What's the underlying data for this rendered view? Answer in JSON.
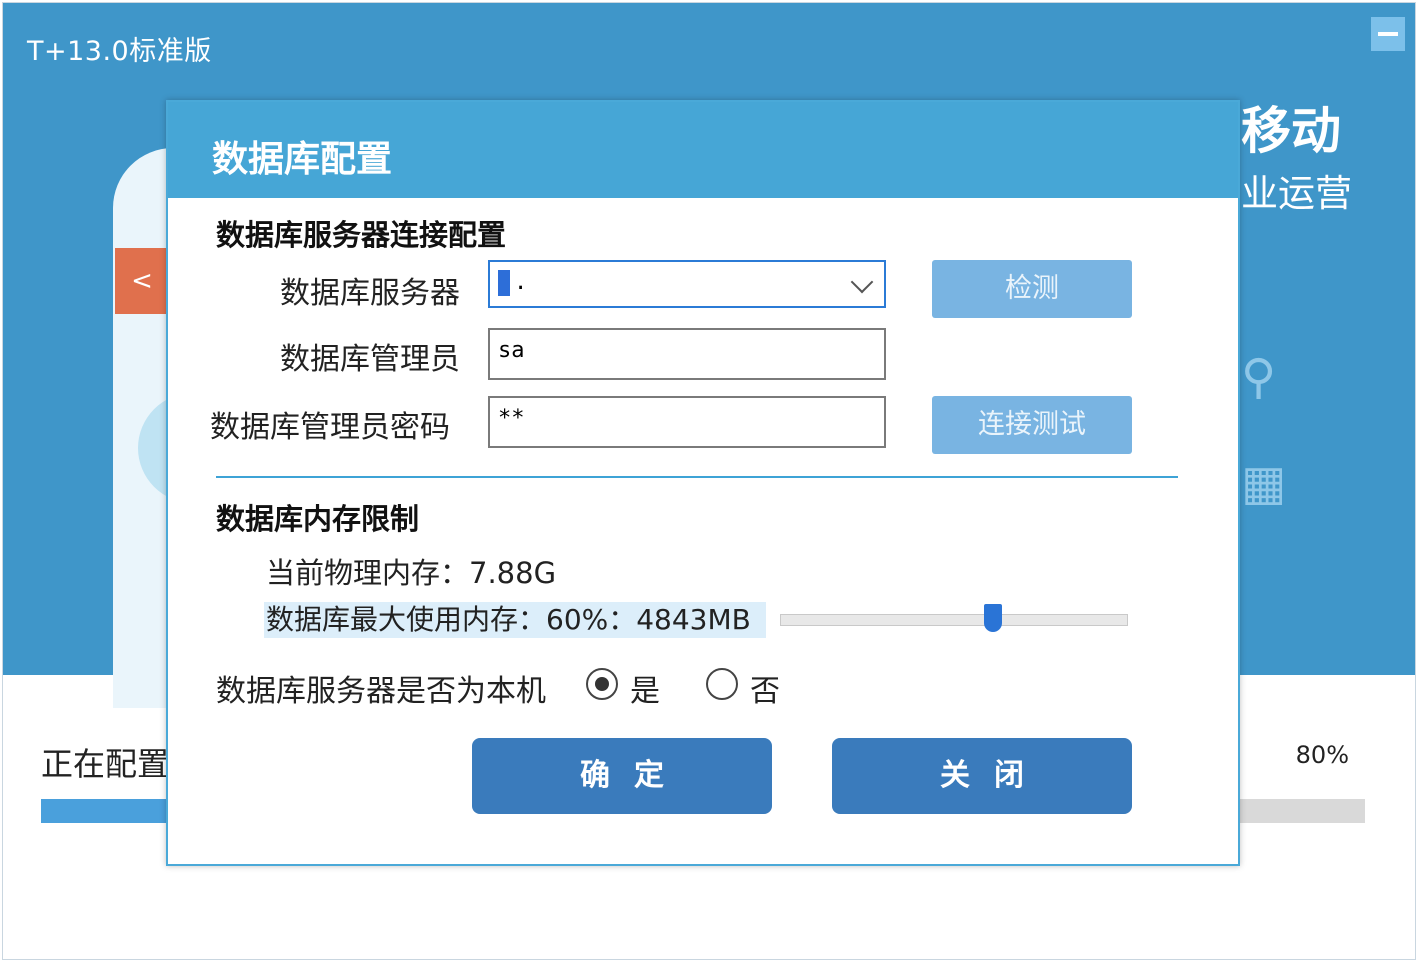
{
  "background": {
    "app_title": "T+13.0标准版",
    "promo_line1": "移动",
    "promo_line2": "业运营",
    "prev_arrow": "<",
    "progress_label": "正在配置",
    "progress_percent": "80%",
    "progress_value": 0.8
  },
  "dialog": {
    "title": "数据库配置",
    "connection_section_title": "数据库服务器连接配置",
    "server_label": "数据库服务器",
    "server_value": ".",
    "admin_label": "数据库管理员",
    "admin_value": "sa",
    "password_label": "数据库管理员密码",
    "password_value": "**",
    "detect_button": "检测",
    "test_connection_button": "连接测试",
    "memory_section_title": "数据库内存限制",
    "physical_memory_text": "当前物理内存：7.88G",
    "max_memory_text": "数据库最大使用内存：60%：4843MB",
    "memory_slider_value_percent": 60,
    "is_local_label": "数据库服务器是否为本机",
    "radio_yes_label": "是",
    "radio_no_label": "否",
    "radio_selected": "是",
    "confirm_button": "确定",
    "close_button": "关闭"
  },
  "colors": {
    "header_blue": "#46a6d6",
    "background_blue": "#3f96c9",
    "button_blue": "#3a7bbc",
    "disabled_button": "#79b4e2"
  }
}
